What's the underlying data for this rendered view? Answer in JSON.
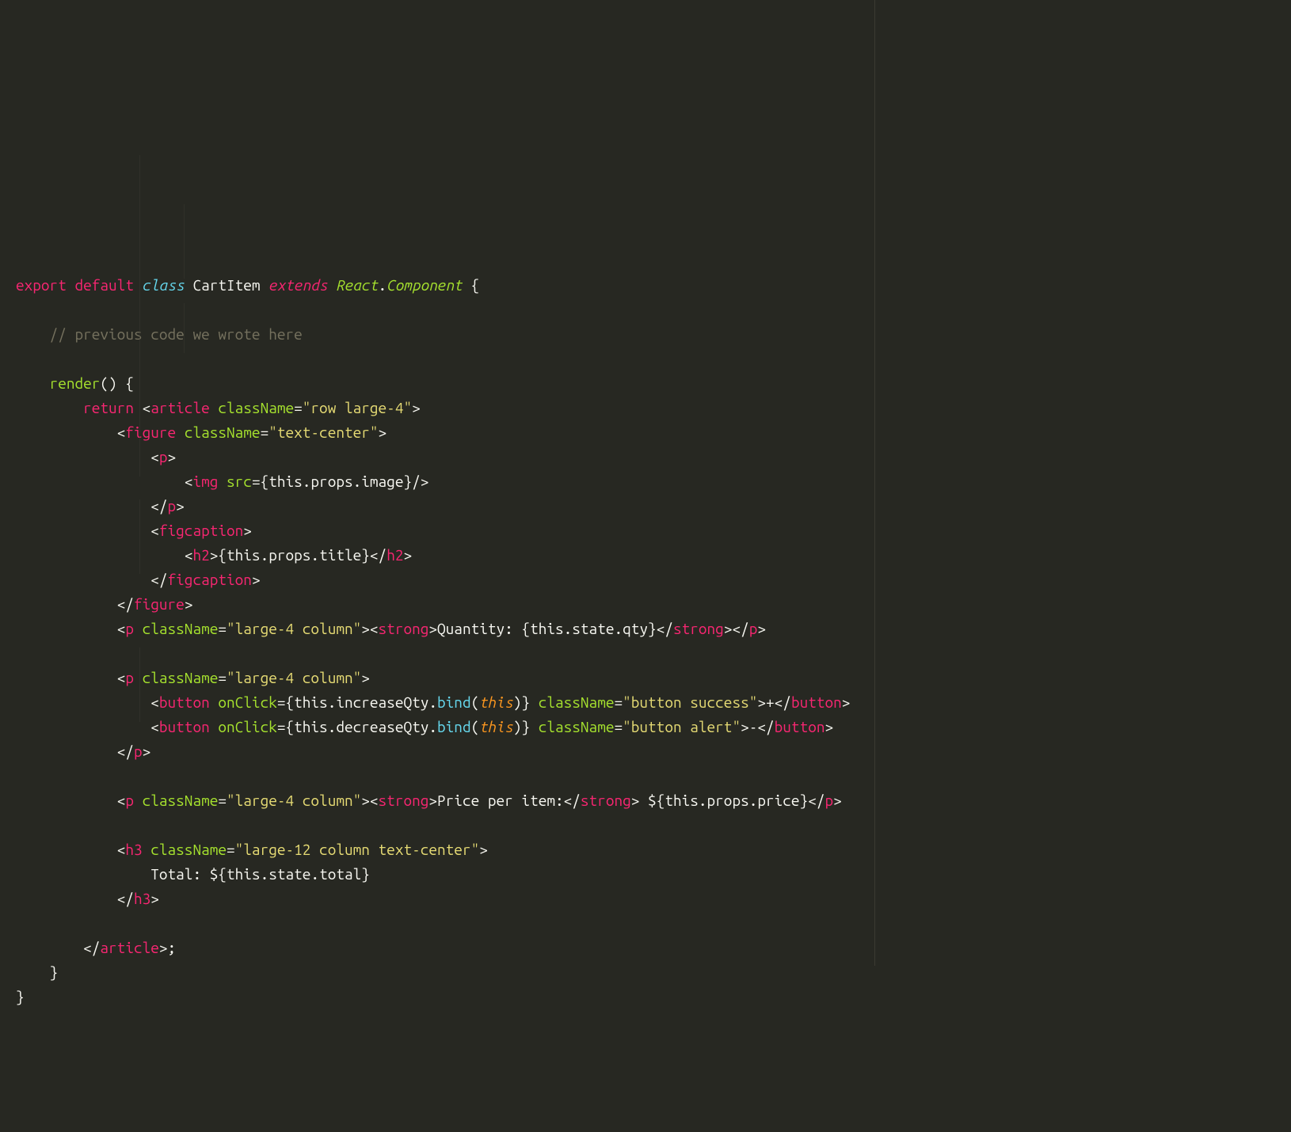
{
  "line1": {
    "export": "export",
    "default": "default",
    "class": "class",
    "name": "CartItem",
    "extends": "extends",
    "react": "React",
    "dot": ".",
    "component": "Component",
    "brace": " {"
  },
  "line3": {
    "indent": "    ",
    "comment": "// previous code we wrote here"
  },
  "line5": {
    "indent": "    ",
    "render": "render",
    "rest": "() {"
  },
  "line6": {
    "indent": "        ",
    "return": "return",
    "sp": " ",
    "lt": "<",
    "tag": "article",
    "sp2": " ",
    "attr": "className",
    "eq": "=",
    "str": "\"row large-4\"",
    "gt": ">"
  },
  "line7": {
    "indent": "            ",
    "lt": "<",
    "tag": "figure",
    "sp": " ",
    "attr": "className",
    "eq": "=",
    "str": "\"text-center\"",
    "gt": ">"
  },
  "line8": {
    "indent": "                ",
    "lt": "<",
    "tag": "p",
    "gt": ">"
  },
  "line9": {
    "indent": "                    ",
    "lt": "<",
    "tag": "img",
    "sp": " ",
    "attr": "src",
    "eq": "=",
    "ob": "{",
    "this": "this",
    "dot1": ".",
    "props": "props",
    "dot2": ".",
    "image": "image",
    "cb": "}",
    "end": "/>"
  },
  "line10": {
    "indent": "                ",
    "lt": "</",
    "tag": "p",
    "gt": ">"
  },
  "line11": {
    "indent": "                ",
    "lt": "<",
    "tag": "figcaption",
    "gt": ">"
  },
  "line12": {
    "indent": "                    ",
    "lt": "<",
    "tag": "h2",
    "gt": ">",
    "ob": "{",
    "this": "this",
    "dot1": ".",
    "props": "props",
    "dot2": ".",
    "title": "title",
    "cb": "}",
    "lt2": "</",
    "tag2": "h2",
    "gt2": ">"
  },
  "line13": {
    "indent": "                ",
    "lt": "</",
    "tag": "figcaption",
    "gt": ">"
  },
  "line14": {
    "indent": "            ",
    "lt": "</",
    "tag": "figure",
    "gt": ">"
  },
  "line15": {
    "indent": "            ",
    "lt": "<",
    "tag": "p",
    "sp": " ",
    "attr": "className",
    "eq": "=",
    "str": "\"large-4 column\"",
    "gt": ">",
    "lt2": "<",
    "tag2": "strong",
    "gt2": ">",
    "txt": "Quantity: ",
    "ob": "{",
    "this": "this",
    "dot1": ".",
    "state": "state",
    "dot2": ".",
    "qty": "qty",
    "cb": "}",
    "lt3": "</",
    "tag3": "strong",
    "gt3": ">",
    "lt4": "</",
    "tag4": "p",
    "gt4": ">"
  },
  "line17": {
    "indent": "            ",
    "lt": "<",
    "tag": "p",
    "sp": " ",
    "attr": "className",
    "eq": "=",
    "str": "\"large-4 column\"",
    "gt": ">"
  },
  "line18": {
    "indent": "                ",
    "lt": "<",
    "tag": "button",
    "sp": " ",
    "attr1": "onClick",
    "eq1": "=",
    "ob": "{",
    "this": "this",
    "dot1": ".",
    "fn": "increaseQty",
    "dot2": ".",
    "bind": "bind",
    "op": "(",
    "this2": "this",
    "cp": ")",
    "cb": "}",
    "sp2": " ",
    "attr2": "className",
    "eq2": "=",
    "str": "\"button success\"",
    "gt": ">",
    "txt": "+",
    "lt2": "</",
    "tag2": "button",
    "gt2": ">"
  },
  "line19": {
    "indent": "                ",
    "lt": "<",
    "tag": "button",
    "sp": " ",
    "attr1": "onClick",
    "eq1": "=",
    "ob": "{",
    "this": "this",
    "dot1": ".",
    "fn": "decreaseQty",
    "dot2": ".",
    "bind": "bind",
    "op": "(",
    "this2": "this",
    "cp": ")",
    "cb": "}",
    "sp2": " ",
    "attr2": "className",
    "eq2": "=",
    "str": "\"button alert\"",
    "gt": ">",
    "txt": "-",
    "lt2": "</",
    "tag2": "button",
    "gt2": ">"
  },
  "line20": {
    "indent": "            ",
    "lt": "</",
    "tag": "p",
    "gt": ">"
  },
  "line22": {
    "indent": "            ",
    "lt": "<",
    "tag": "p",
    "sp": " ",
    "attr": "className",
    "eq": "=",
    "str": "\"large-4 column\"",
    "gt": ">",
    "lt2": "<",
    "tag2": "strong",
    "gt2": ">",
    "txt": "Price per item:",
    "lt3": "</",
    "tag3": "strong",
    "gt3": ">",
    "sp2": " $",
    "ob": "{",
    "this": "this",
    "dot1": ".",
    "props": "props",
    "dot2": ".",
    "price": "price",
    "cb": "}",
    "lt4": "</",
    "tag4": "p",
    "gt4": ">"
  },
  "line24": {
    "indent": "            ",
    "lt": "<",
    "tag": "h3",
    "sp": " ",
    "attr": "className",
    "eq": "=",
    "str": "\"large-12 column text-center\"",
    "gt": ">"
  },
  "line25": {
    "indent": "                ",
    "txt": "Total: $",
    "ob": "{",
    "this": "this",
    "dot1": ".",
    "state": "state",
    "dot2": ".",
    "total": "total",
    "cb": "}"
  },
  "line26": {
    "indent": "            ",
    "lt": "</",
    "tag": "h3",
    "gt": ">"
  },
  "line28": {
    "indent": "        ",
    "lt": "</",
    "tag": "article",
    "gt": ">",
    "semi": ";"
  },
  "line29": {
    "indent": "    ",
    "brace": "}"
  },
  "line30": {
    "brace": "}"
  }
}
